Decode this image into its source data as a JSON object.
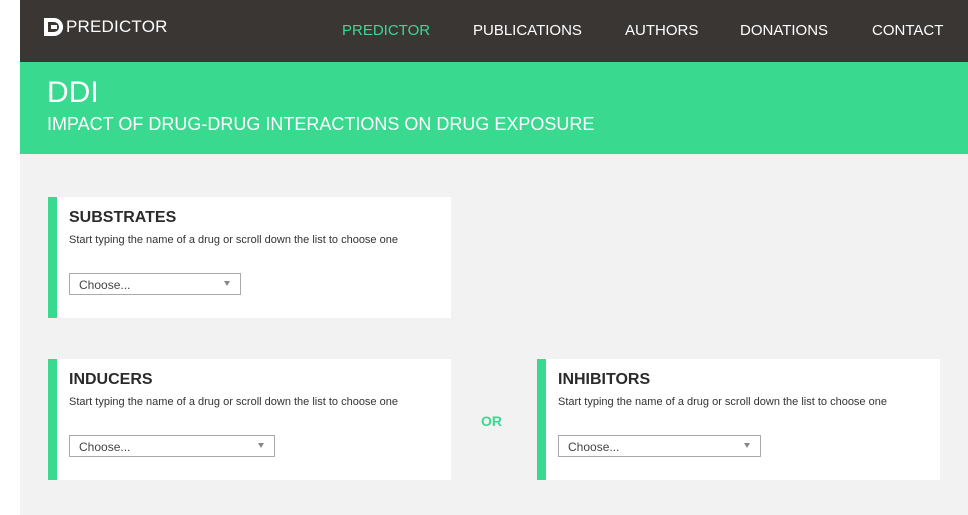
{
  "brand": {
    "name": "PREDICTOR",
    "accent": "#39d990"
  },
  "nav": {
    "items": [
      {
        "label": "PREDICTOR",
        "active": true
      },
      {
        "label": "PUBLICATIONS",
        "active": false
      },
      {
        "label": "AUTHORS",
        "active": false
      },
      {
        "label": "DONATIONS",
        "active": false
      },
      {
        "label": "CONTACT",
        "active": false
      }
    ]
  },
  "hero": {
    "title": "DDI",
    "subtitle": "IMPACT OF DRUG-DRUG INTERACTIONS ON DRUG EXPOSURE"
  },
  "sections": {
    "substrates": {
      "title": "SUBSTRATES",
      "description": "Start typing the name of a drug or scroll down the list to choose one",
      "select_value": "Choose..."
    },
    "inducers": {
      "title": "INDUCERS",
      "description": "Start typing the name of a drug or scroll down the list to choose one",
      "select_value": "Choose..."
    },
    "inhibitors": {
      "title": "INHIBITORS",
      "description": "Start typing the name of a drug or scroll down the list to choose one",
      "select_value": "Choose..."
    }
  },
  "or_label": "OR"
}
